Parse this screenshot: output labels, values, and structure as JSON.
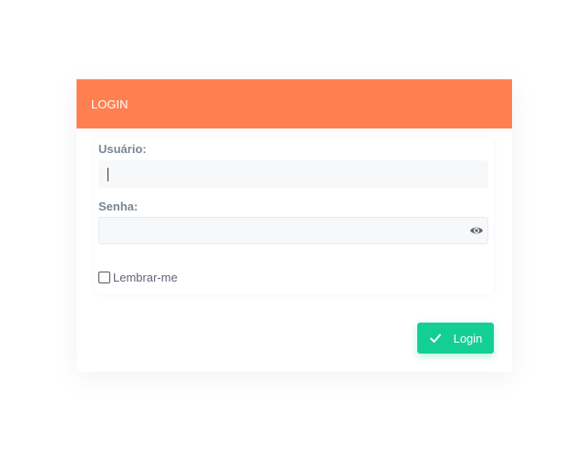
{
  "header": {
    "title": "LOGIN",
    "color": "#ff7f50"
  },
  "form": {
    "username_label": "Usuário:",
    "username_value": "",
    "password_label": "Senha:",
    "password_value": "",
    "remember_label": "Lembrar-me",
    "remember_checked": false
  },
  "actions": {
    "login_label": "Login",
    "login_color": "#14cf93"
  },
  "icons": {
    "password_toggle": "eye-icon",
    "login_check": "check-icon"
  }
}
